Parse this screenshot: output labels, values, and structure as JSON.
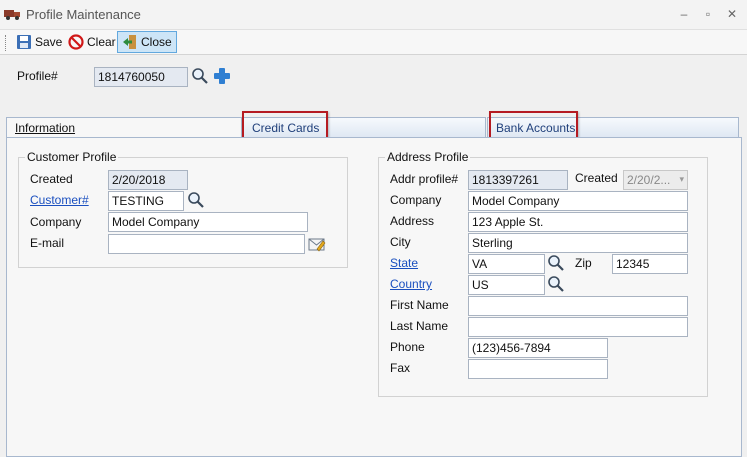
{
  "window": {
    "title": "Profile Maintenance",
    "minimize": "–",
    "restore": "▫",
    "close": "✕"
  },
  "toolbar": {
    "save_label": "Save",
    "clear_label": "Clear",
    "close_label": "Close"
  },
  "profile": {
    "label": "Profile#",
    "value": "1814760050"
  },
  "tabs": {
    "information": "Information",
    "credit_cards": "Credit Cards",
    "bank_accounts": "Bank Accounts"
  },
  "customer_profile": {
    "title": "Customer Profile",
    "created_label": "Created",
    "created_value": "2/20/2018",
    "customer_label": "Customer#",
    "customer_value": "TESTING",
    "company_label": "Company",
    "company_value": "Model Company",
    "email_label": "E-mail",
    "email_value": ""
  },
  "address_profile": {
    "title": "Address Profile",
    "addr_profile_label": "Addr profile#",
    "addr_profile_value": "1813397261",
    "created_label": "Created",
    "created_value": "2/20/2...",
    "company_label": "Company",
    "company_value": "Model Company",
    "address_label": "Address",
    "address_value": "123 Apple St.",
    "city_label": "City",
    "city_value": "Sterling",
    "state_label": "State",
    "state_value": "VA",
    "zip_label": "Zip",
    "zip_value": "12345",
    "country_label": "Country",
    "country_value": "US",
    "first_name_label": "First Name",
    "first_name_value": "",
    "last_name_label": "Last Name",
    "last_name_value": "",
    "phone_label": "Phone",
    "phone_value": "(123)456-7894",
    "fax_label": "Fax",
    "fax_value": ""
  },
  "colors": {
    "highlight": "#b51b22",
    "link": "#1a4fbf",
    "readonly_field": "#e4e9f1",
    "close_button": "#cde5f7"
  }
}
